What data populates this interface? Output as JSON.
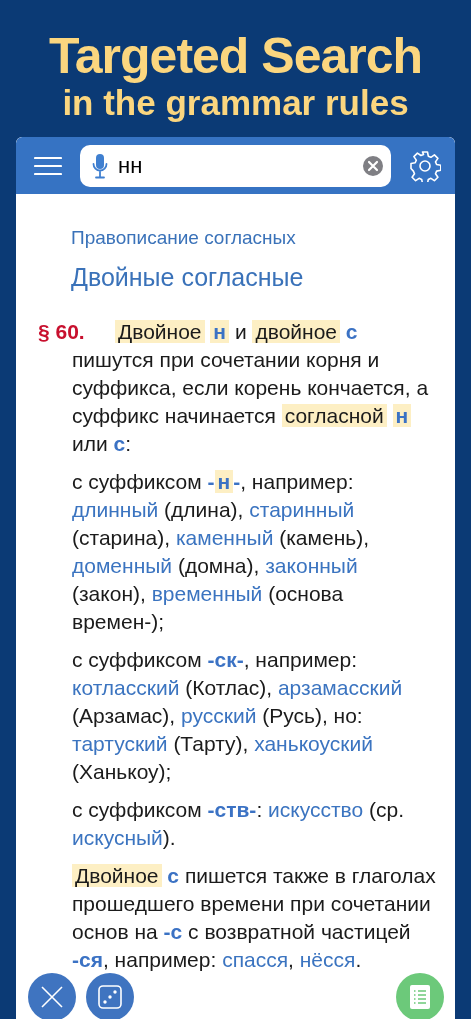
{
  "banner": {
    "line_1": "Targeted Search",
    "line_2": "in the grammar rules"
  },
  "toolbar": {
    "search": {
      "value": "нн"
    }
  },
  "article": {
    "section": "Правописание согласных",
    "title": "Двойные согласные",
    "number": "§ 60.",
    "paragraphs": [
      {
        "segments": [
          {
            "text": "Двойное ",
            "kind": "hit"
          },
          {
            "text": "н",
            "kind": "hitmark"
          },
          {
            "text": " и ",
            "kind": "plain"
          },
          {
            "text": "двойное ",
            "kind": "hit"
          },
          {
            "text": "с",
            "kind": "mark"
          },
          {
            "text": " пишутся при сочетании корня и суффикса, если корень кончается, а суффикс начинается ",
            "kind": "plain"
          },
          {
            "text": "согласной ",
            "kind": "hit"
          },
          {
            "text": "н",
            "kind": "hitmark"
          },
          {
            "text": " или ",
            "kind": "plain"
          },
          {
            "text": "с",
            "kind": "mark"
          },
          {
            "text": ":",
            "kind": "plain"
          }
        ]
      },
      {
        "segments": [
          {
            "text": "с суффиксом ",
            "kind": "plain"
          },
          {
            "text": "-",
            "kind": "mark"
          },
          {
            "text": "н",
            "kind": "hitmark"
          },
          {
            "text": "-",
            "kind": "mark"
          },
          {
            "text": ", например: ",
            "kind": "plain"
          },
          {
            "text": "длинный",
            "kind": "example"
          },
          {
            "text": " (длина), ",
            "kind": "plain"
          },
          {
            "text": "старинный",
            "kind": "example"
          },
          {
            "text": " (старина), ",
            "kind": "plain"
          },
          {
            "text": "каменный",
            "kind": "example"
          },
          {
            "text": " (камень), ",
            "kind": "plain"
          },
          {
            "text": "доменный",
            "kind": "example"
          },
          {
            "text": " (домна), ",
            "kind": "plain"
          },
          {
            "text": "законный",
            "kind": "example"
          },
          {
            "text": " (закон), ",
            "kind": "plain"
          },
          {
            "text": "временный",
            "kind": "example"
          },
          {
            "text": " (основа времен-);",
            "kind": "plain"
          }
        ]
      },
      {
        "segments": [
          {
            "text": "с суффиксом ",
            "kind": "plain"
          },
          {
            "text": "-ск-",
            "kind": "mark"
          },
          {
            "text": ", например: ",
            "kind": "plain"
          },
          {
            "text": "котласский",
            "kind": "example"
          },
          {
            "text": " (Котлас), ",
            "kind": "plain"
          },
          {
            "text": "арзамасский",
            "kind": "example"
          },
          {
            "text": " (Арзамас), ",
            "kind": "plain"
          },
          {
            "text": "русский",
            "kind": "example"
          },
          {
            "text": " (Русь), но: ",
            "kind": "plain"
          },
          {
            "text": "тартуский",
            "kind": "example"
          },
          {
            "text": " (Тарту), ",
            "kind": "plain"
          },
          {
            "text": "ханькоуский",
            "kind": "example"
          },
          {
            "text": " (Ханькоу);",
            "kind": "plain"
          }
        ]
      },
      {
        "segments": [
          {
            "text": "с суффиксом ",
            "kind": "plain"
          },
          {
            "text": "-ств-",
            "kind": "mark"
          },
          {
            "text": ": ",
            "kind": "plain"
          },
          {
            "text": "искусство",
            "kind": "example"
          },
          {
            "text": " (ср. ",
            "kind": "plain"
          },
          {
            "text": "искусный",
            "kind": "example"
          },
          {
            "text": ").",
            "kind": "plain"
          }
        ]
      },
      {
        "segments": [
          {
            "text": "Двойное ",
            "kind": "hit"
          },
          {
            "text": "с",
            "kind": "mark"
          },
          {
            "text": " пишется также в глаголах прошедшего времени при сочетании основ на ",
            "kind": "plain"
          },
          {
            "text": "-с",
            "kind": "mark"
          },
          {
            "text": " с возвратной частицей ",
            "kind": "plain"
          },
          {
            "text": "-ся",
            "kind": "mark"
          },
          {
            "text": ", например: ",
            "kind": "plain"
          },
          {
            "text": "спасся",
            "kind": "example"
          },
          {
            "text": ", ",
            "kind": "plain"
          },
          {
            "text": "нёсся",
            "kind": "example"
          },
          {
            "text": ".",
            "kind": "plain"
          }
        ]
      }
    ]
  }
}
